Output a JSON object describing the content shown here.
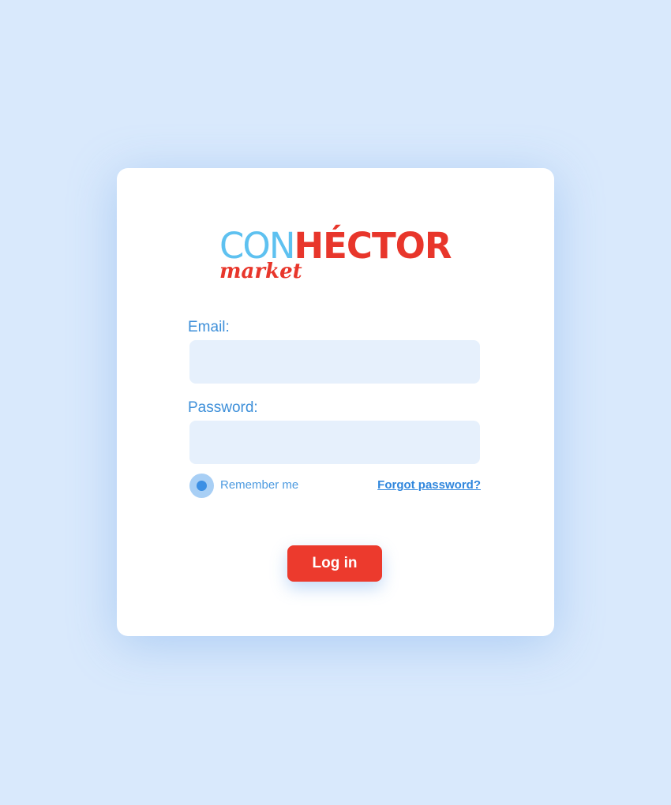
{
  "logo": {
    "con": "CON",
    "hector": "HÉCTOR",
    "market": "market"
  },
  "form": {
    "email_label": "Email:",
    "email_value": "",
    "password_label": "Password:",
    "password_value": "",
    "remember_label": "Remember me",
    "remember_checked": true,
    "forgot_label": "Forgot password?",
    "login_label": "Log in"
  },
  "colors": {
    "background": "#d9e9fc",
    "card": "#ffffff",
    "input_fill": "#e6f0fc",
    "label_blue": "#3d8fd9",
    "accent_red": "#ec3a2d",
    "logo_light_blue": "#5ec1f0"
  }
}
